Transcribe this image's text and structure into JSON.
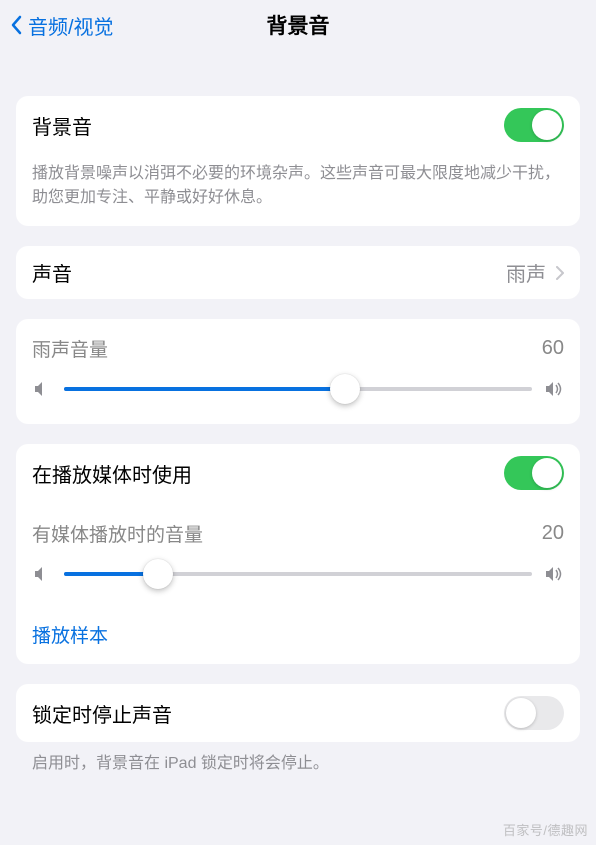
{
  "header": {
    "back_label": "音频/视觉",
    "title": "背景音"
  },
  "main_toggle": {
    "label": "背景音",
    "on": true,
    "description": "播放背景噪声以消弭不必要的环境杂声。这些声音可最大限度地减少干扰，助您更加专注、平静或好好休息。"
  },
  "sound_row": {
    "label": "声音",
    "value": "雨声"
  },
  "volume": {
    "label": "雨声音量",
    "value": 60
  },
  "media": {
    "use_label": "在播放媒体时使用",
    "use_on": true,
    "volume_label": "有媒体播放时的音量",
    "volume_value": 20,
    "sample_link": "播放样本"
  },
  "lock": {
    "label": "锁定时停止声音",
    "on": false,
    "description": "启用时，背景音在 iPad 锁定时将会停止。"
  },
  "watermark": "百家号/德趣网"
}
